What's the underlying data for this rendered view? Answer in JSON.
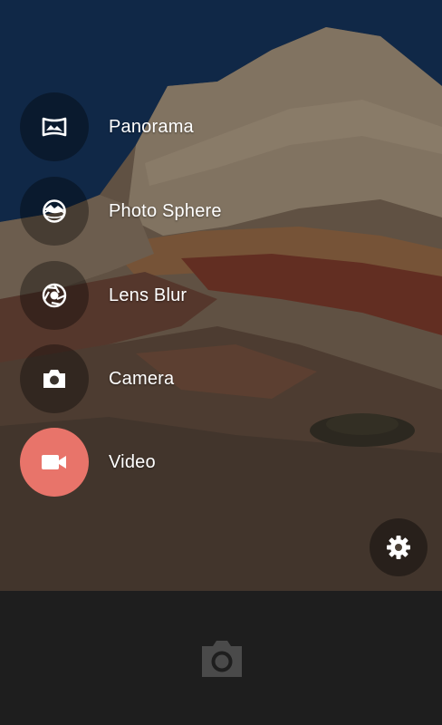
{
  "modes": [
    {
      "label": "Panorama",
      "icon": "panorama-icon",
      "active": false
    },
    {
      "label": "Photo Sphere",
      "icon": "photo-sphere-icon",
      "active": false
    },
    {
      "label": "Lens Blur",
      "icon": "lens-blur-icon",
      "active": false
    },
    {
      "label": "Camera",
      "icon": "camera-icon",
      "active": false
    },
    {
      "label": "Video",
      "icon": "video-icon",
      "active": true
    }
  ],
  "settings": {
    "icon": "gear-icon"
  },
  "shutter": {
    "icon": "camera-shutter-icon"
  },
  "colors": {
    "active_accent": "#e8746a",
    "bottom_bar": "#1e1e1e"
  }
}
